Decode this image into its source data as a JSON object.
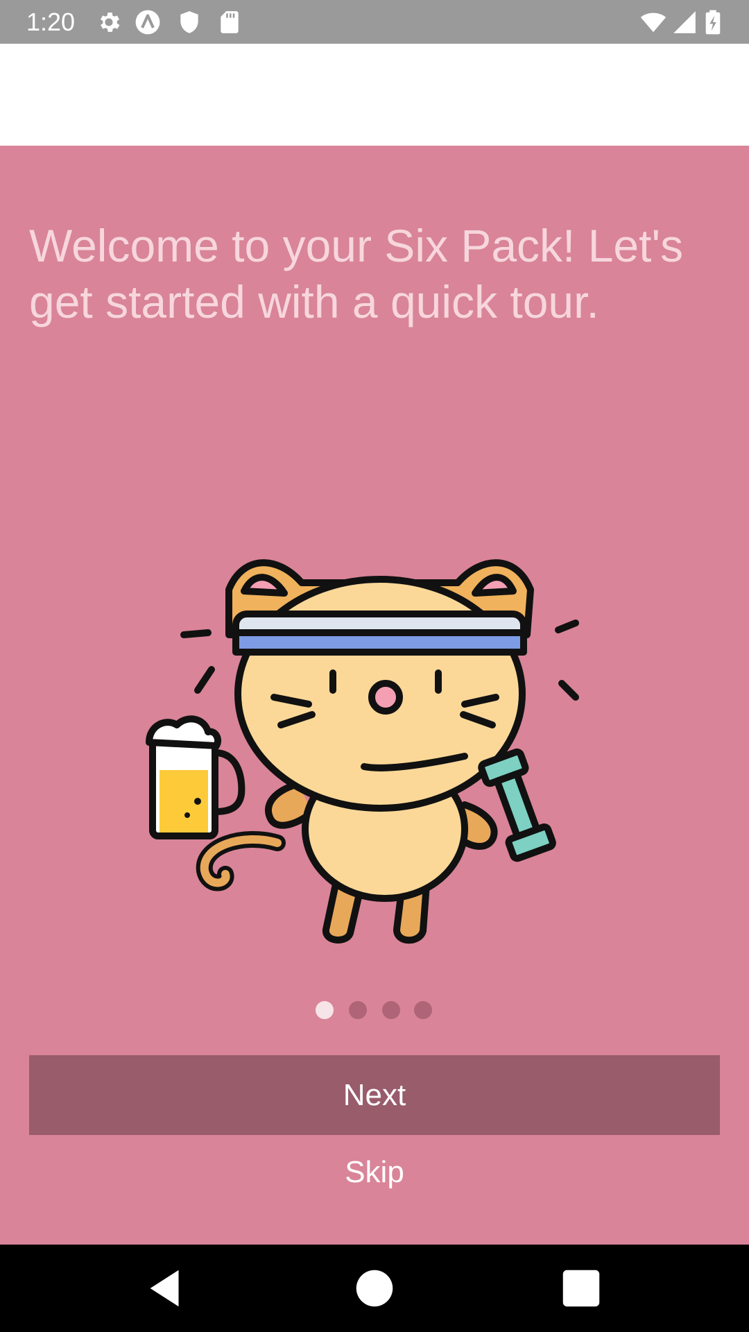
{
  "status_bar": {
    "time": "1:20",
    "left_icons": [
      "gear-icon",
      "a-circle-icon",
      "shield-icon",
      "sd-card-icon"
    ],
    "right_icons": [
      "wifi-icon",
      "signal-icon",
      "battery-charging-icon"
    ]
  },
  "onboarding": {
    "welcome_text": "Welcome to your Six Pack! Let's get started with a quick tour.",
    "illustration": "cat-with-beer-and-dumbbell-illustration",
    "page_indicator": {
      "pages": 4,
      "current": 1
    },
    "next_label": "Next",
    "skip_label": "Skip"
  },
  "nav_bar": {
    "buttons": [
      "back-icon",
      "home-icon",
      "recents-icon"
    ]
  },
  "colors": {
    "status_bar": "#9a9a9a",
    "background": "#d98498",
    "welcome_text": "#f7d6dd",
    "next_button": "#985c6b",
    "dot_inactive": "#b06477",
    "dot_active": "#f6e4e8",
    "nav_bar": "#000000"
  }
}
